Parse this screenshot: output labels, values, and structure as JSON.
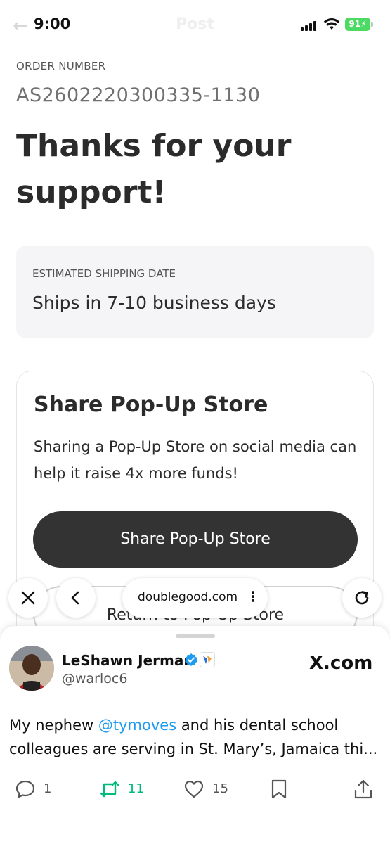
{
  "status_bar": {
    "time": "9:00",
    "faded_title": "Post",
    "battery": "91"
  },
  "order": {
    "label": "ORDER NUMBER",
    "number": "AS2602220300335-1130"
  },
  "headline": "Thanks for your support!",
  "shipping": {
    "label": "ESTIMATED SHIPPING DATE",
    "value": "Ships in 7-10 business days"
  },
  "share_card": {
    "title": "Share Pop-Up Store",
    "description": "Sharing a Pop-Up Store on social media can help it raise 4x more funds!",
    "share_button": "Share Pop-Up Store",
    "return_button": "Return to Pop-Up Store"
  },
  "browser": {
    "url": "doublegood.com",
    "more": "⋮"
  },
  "tweet": {
    "author": "LeShawn Jerman",
    "handle": "@warloc6",
    "source": "X.com",
    "text_before": "My nephew ",
    "mention": "@tymoves",
    "text_after": " and his dental school colleagues are serving in St. Mary’s, Jamaica thi...",
    "replies": "1",
    "retweets": "11",
    "likes": "15"
  },
  "colors": {
    "brand_dark": "#333333",
    "mention_blue": "#1d9bf0",
    "retweet_green": "#00ba7c",
    "battery_green": "#4cd964"
  }
}
